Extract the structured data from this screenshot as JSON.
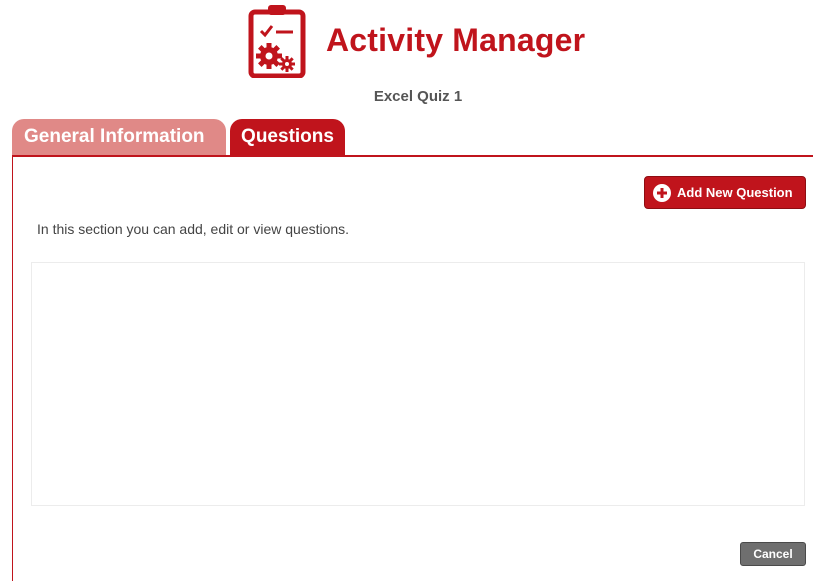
{
  "header": {
    "app_title": "Activity Manager",
    "logo_icon": "clipboard-gear-icon",
    "activity_name": "Excel Quiz 1"
  },
  "tabs": [
    {
      "label": "General Information",
      "active": false
    },
    {
      "label": "Questions",
      "active": true
    }
  ],
  "questions_section": {
    "add_button_label": "Add New Question",
    "add_button_icon": "plus-circle-icon",
    "description": "In this section you can add, edit or view questions.",
    "questions": []
  },
  "footer": {
    "cancel_label": "Cancel"
  },
  "colors": {
    "accent": "#c0141c",
    "inactive_tab": "#e08987",
    "cancel_button": "#6f6f6f"
  }
}
